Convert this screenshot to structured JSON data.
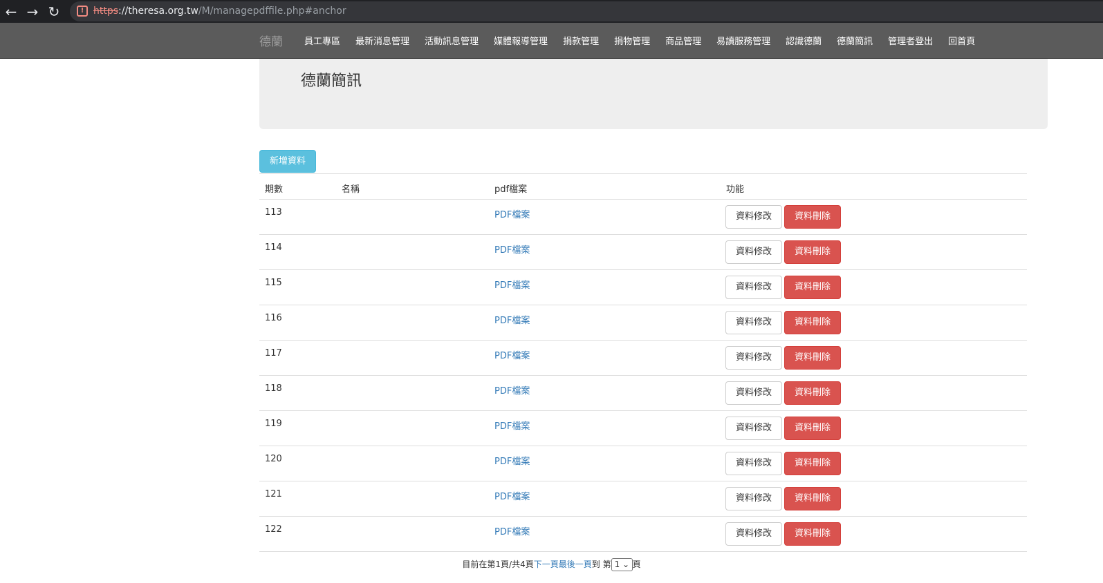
{
  "browser": {
    "url_scheme": "https",
    "url_host": "://theresa.org.tw",
    "url_path": "/M/managepdffile.php#anchor",
    "back_icon": "back-arrow-icon",
    "forward_icon": "forward-arrow-icon",
    "reload_icon": "reload-icon"
  },
  "navbar": {
    "brand": "德蘭",
    "items": [
      "員工專區",
      "最新消息管理",
      "活動訊息管理",
      "媒體報導管理",
      "捐款管理",
      "捐物管理",
      "商品管理",
      "易讀服務管理",
      "認識德蘭",
      "德蘭簡訊",
      "管理者登出",
      "回首頁"
    ]
  },
  "page": {
    "title": "德蘭簡訊",
    "add_label": "新增資料"
  },
  "table": {
    "headers": [
      "期數",
      "名稱",
      "pdf檔案",
      "功能"
    ],
    "rows": [
      {
        "issue": "113",
        "name": "",
        "pdf": "PDF檔案",
        "edit": "資料修改",
        "delete": "資料刪除"
      },
      {
        "issue": "114",
        "name": "",
        "pdf": "PDF檔案",
        "edit": "資料修改",
        "delete": "資料刪除"
      },
      {
        "issue": "115",
        "name": "",
        "pdf": "PDF檔案",
        "edit": "資料修改",
        "delete": "資料刪除"
      },
      {
        "issue": "116",
        "name": "",
        "pdf": "PDF檔案",
        "edit": "資料修改",
        "delete": "資料刪除"
      },
      {
        "issue": "117",
        "name": "",
        "pdf": "PDF檔案",
        "edit": "資料修改",
        "delete": "資料刪除"
      },
      {
        "issue": "118",
        "name": "",
        "pdf": "PDF檔案",
        "edit": "資料修改",
        "delete": "資料刪除"
      },
      {
        "issue": "119",
        "name": "",
        "pdf": "PDF檔案",
        "edit": "資料修改",
        "delete": "資料刪除"
      },
      {
        "issue": "120",
        "name": "",
        "pdf": "PDF檔案",
        "edit": "資料修改",
        "delete": "資料刪除"
      },
      {
        "issue": "121",
        "name": "",
        "pdf": "PDF檔案",
        "edit": "資料修改",
        "delete": "資料刪除"
      },
      {
        "issue": "122",
        "name": "",
        "pdf": "PDF檔案",
        "edit": "資料修改",
        "delete": "資料刪除"
      }
    ]
  },
  "pager": {
    "status": "目前在第1頁/共4頁",
    "next": "下一頁",
    "last": "最後一頁",
    "goto_prefix": "到 第",
    "page_select": "1",
    "goto_suffix": "頁"
  },
  "colors": {
    "navbar_bg": "#5b5b5b",
    "info_button": "#5bc0de",
    "danger_button": "#d9534f",
    "link": "#337ab7"
  }
}
